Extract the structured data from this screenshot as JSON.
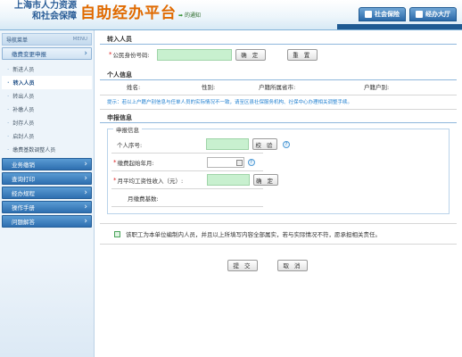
{
  "header": {
    "org_line1": "上海市人力资源",
    "org_line2": "和社会保障",
    "brand": "自助经办平台",
    "notice": "的通知",
    "tabs": [
      {
        "label": "社会保险",
        "icon": "shield-icon"
      },
      {
        "label": "经办大厅",
        "icon": "building-icon"
      }
    ]
  },
  "sidebar": {
    "head_title": "导航菜单",
    "head_menu": "MENU",
    "groups": [
      {
        "label": "缴费变更申报"
      },
      {
        "label": "业务缴销"
      },
      {
        "label": "查询打印"
      },
      {
        "label": "经办规程"
      },
      {
        "label": "操作手册"
      },
      {
        "label": "问题解答"
      }
    ],
    "sub_items": [
      "新进人员",
      "转入人员",
      "转出人员",
      "补缴人员",
      "封存人员",
      "启封人员",
      "缴费基数调整人员"
    ]
  },
  "form": {
    "transfer_section": "转入人员",
    "id_label": "公民身份号码:",
    "id_value": "",
    "confirm_btn": "确 定",
    "reset_btn": "重 置",
    "personal_section": "个人信息",
    "name_label": "姓名:",
    "gender_label": "性别:",
    "province_label": "户籍所属省市:",
    "hukou_label": "户籍户别:",
    "hint": "提示：若以上户籍户别信息与任单人员的实际情况不一致，请至区县社保服务机构、社保中心办理相关调整手续。",
    "declare_section": "申报信息",
    "declare_legend": "申报信息",
    "seq_label": "个人序号:",
    "verify_btn": "校 验",
    "start_label": "缴费起始年月:",
    "income_label": "月平均工资性收入（元）:",
    "confirm_btn2": "确 定",
    "base_label": "月缴费基数:",
    "declaration": "该职工为本单位编制内人员，并且以上所填写内容全部属实，若与实际情况不符，愿承担相关责任。",
    "submit_btn": "提 交",
    "cancel_btn": "取 消"
  },
  "colors": {
    "brand": "#e06a00",
    "nav_blue": "#2e6fb0",
    "input_green": "#c8f0cf",
    "hint_blue": "#1f7fd0"
  }
}
